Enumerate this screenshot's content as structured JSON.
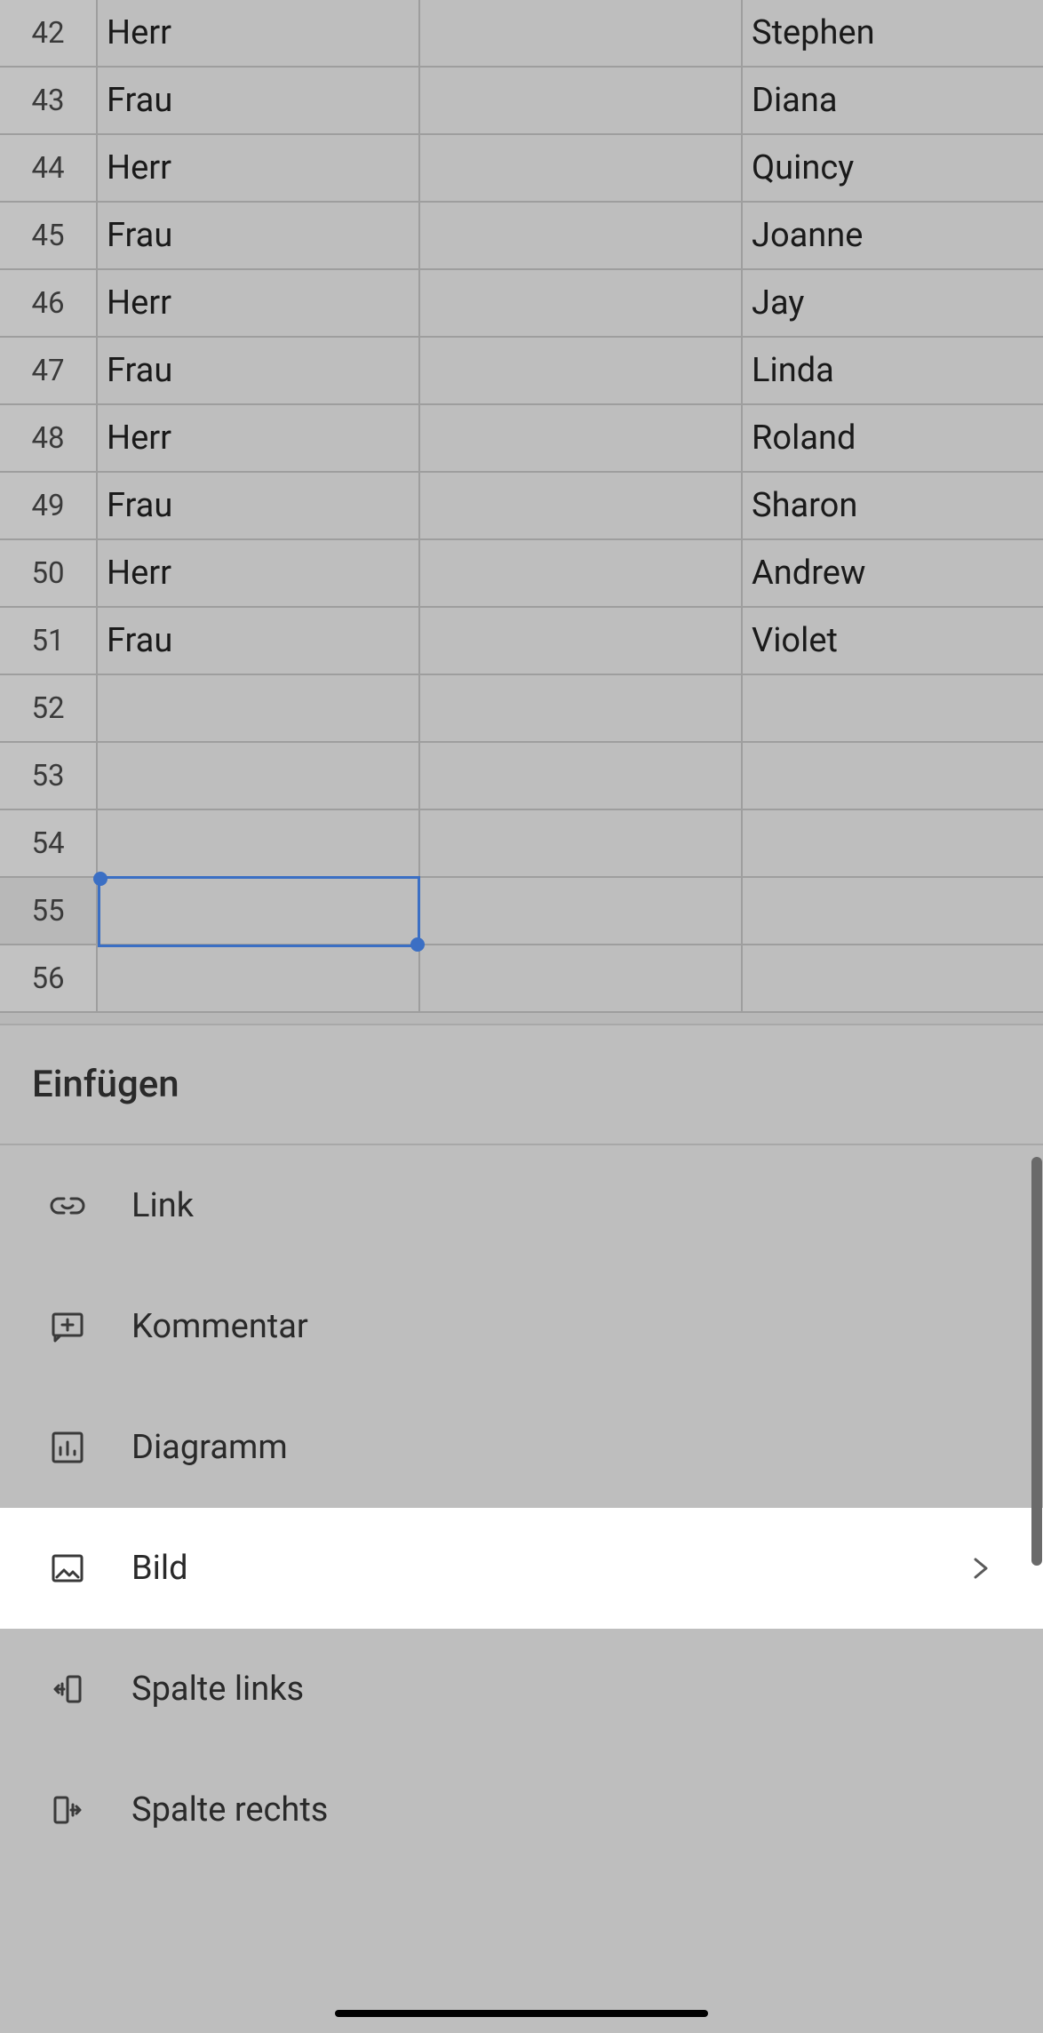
{
  "spreadsheet": {
    "rows": [
      {
        "n": 42,
        "a": "Herr",
        "b": "",
        "c": "Stephen"
      },
      {
        "n": 43,
        "a": "Frau",
        "b": "",
        "c": "Diana"
      },
      {
        "n": 44,
        "a": "Herr",
        "b": "",
        "c": "Quincy"
      },
      {
        "n": 45,
        "a": "Frau",
        "b": "",
        "c": "Joanne"
      },
      {
        "n": 46,
        "a": "Herr",
        "b": "",
        "c": "Jay"
      },
      {
        "n": 47,
        "a": "Frau",
        "b": "",
        "c": "Linda"
      },
      {
        "n": 48,
        "a": "Herr",
        "b": "",
        "c": "Roland"
      },
      {
        "n": 49,
        "a": "Frau",
        "b": "",
        "c": "Sharon"
      },
      {
        "n": 50,
        "a": "Herr",
        "b": "",
        "c": "Andrew"
      },
      {
        "n": 51,
        "a": "Frau",
        "b": "",
        "c": "Violet"
      },
      {
        "n": 52,
        "a": "",
        "b": "",
        "c": ""
      },
      {
        "n": 53,
        "a": "",
        "b": "",
        "c": ""
      },
      {
        "n": 54,
        "a": "",
        "b": "",
        "c": ""
      },
      {
        "n": 55,
        "a": "",
        "b": "",
        "c": ""
      },
      {
        "n": 56,
        "a": "",
        "b": "",
        "c": ""
      }
    ],
    "selected_row_index": 13,
    "selected_cell": {
      "row": 55,
      "col": "A"
    }
  },
  "panel": {
    "title": "Einfügen",
    "items": [
      {
        "label": "Link",
        "icon": "link-icon"
      },
      {
        "label": "Kommentar",
        "icon": "comment-icon"
      },
      {
        "label": "Diagramm",
        "icon": "chart-icon"
      },
      {
        "label": "Bild",
        "icon": "image-icon",
        "chevron": true
      },
      {
        "label": "Spalte links",
        "icon": "column-left-icon"
      },
      {
        "label": "Spalte rechts",
        "icon": "column-right-icon"
      }
    ],
    "highlighted_index": 3
  }
}
